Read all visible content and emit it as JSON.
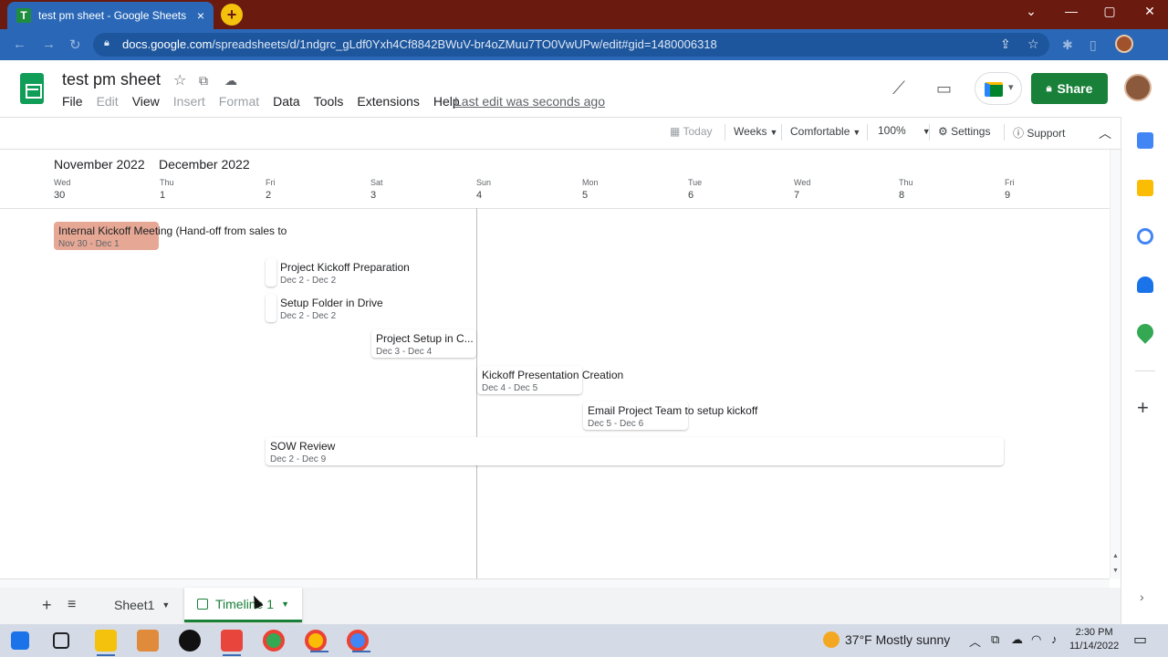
{
  "browser": {
    "tab_title": "test pm sheet - Google Sheets",
    "tab_favicon": "T",
    "tab_close": "×",
    "new_tab": "+",
    "url_domain": "docs.google.com",
    "url_path": "/spreadsheets/d/1ndgrc_gLdf0Yxh4Cf8842BWuV-br4oZMuu7TO0VwUPw/edit#gid=1480006318",
    "win_chevron": "⌄",
    "win_min": "—",
    "win_max": "▢",
    "win_close": "✕"
  },
  "doc": {
    "title": "test pm sheet",
    "menu": [
      {
        "label": "File",
        "enabled": true
      },
      {
        "label": "Edit",
        "enabled": false
      },
      {
        "label": "View",
        "enabled": true
      },
      {
        "label": "Insert",
        "enabled": false
      },
      {
        "label": "Format",
        "enabled": false
      },
      {
        "label": "Data",
        "enabled": true
      },
      {
        "label": "Tools",
        "enabled": true
      },
      {
        "label": "Extensions",
        "enabled": true
      },
      {
        "label": "Help",
        "enabled": true
      }
    ],
    "last_edit": "Last edit was seconds ago",
    "share_label": "Share"
  },
  "timeline_toolbar": {
    "today": "Today",
    "scale": "Weeks",
    "density": "Comfortable",
    "zoom": "100%",
    "settings": "Settings",
    "support": "Support"
  },
  "timeline": {
    "months": [
      "November 2022",
      "December 2022"
    ],
    "days": [
      {
        "dow": "Wed",
        "num": "30"
      },
      {
        "dow": "Thu",
        "num": "1"
      },
      {
        "dow": "Fri",
        "num": "2"
      },
      {
        "dow": "Sat",
        "num": "3"
      },
      {
        "dow": "Sun",
        "num": "4"
      },
      {
        "dow": "Mon",
        "num": "5"
      },
      {
        "dow": "Tue",
        "num": "6"
      },
      {
        "dow": "Wed",
        "num": "7"
      },
      {
        "dow": "Thu",
        "num": "8"
      },
      {
        "dow": "Fri",
        "num": "9"
      }
    ],
    "cards": [
      {
        "title": "Internal Kickoff Meeting (Hand-off from sales to",
        "dates": "Nov 30 - Dec 1",
        "highlight": true
      },
      {
        "title": "Project Kickoff Preparation",
        "dates": "Dec 2 - Dec 2"
      },
      {
        "title": "Setup Folder in Drive",
        "dates": "Dec 2 - Dec 2"
      },
      {
        "title": "Project Setup in C...",
        "dates": "Dec 3 - Dec 4"
      },
      {
        "title": "Kickoff Presentation Creation",
        "dates": "Dec 4 - Dec 5"
      },
      {
        "title": "Email Project Team to setup kickoff",
        "dates": "Dec 5 - Dec 6"
      },
      {
        "title": "SOW Review",
        "dates": "Dec 2 - Dec 9"
      }
    ]
  },
  "sheet_tabs": [
    "Sheet1",
    "Timeline 1"
  ],
  "taskbar": {
    "weather": "37°F  Mostly sunny",
    "time": "2:30 PM",
    "date": "11/14/2022"
  },
  "colors": {
    "accent_green": "#188038",
    "card_highlight": "#e6a895",
    "browser_blue": "#2a68b7",
    "tabstrip": "#6b1a10"
  }
}
